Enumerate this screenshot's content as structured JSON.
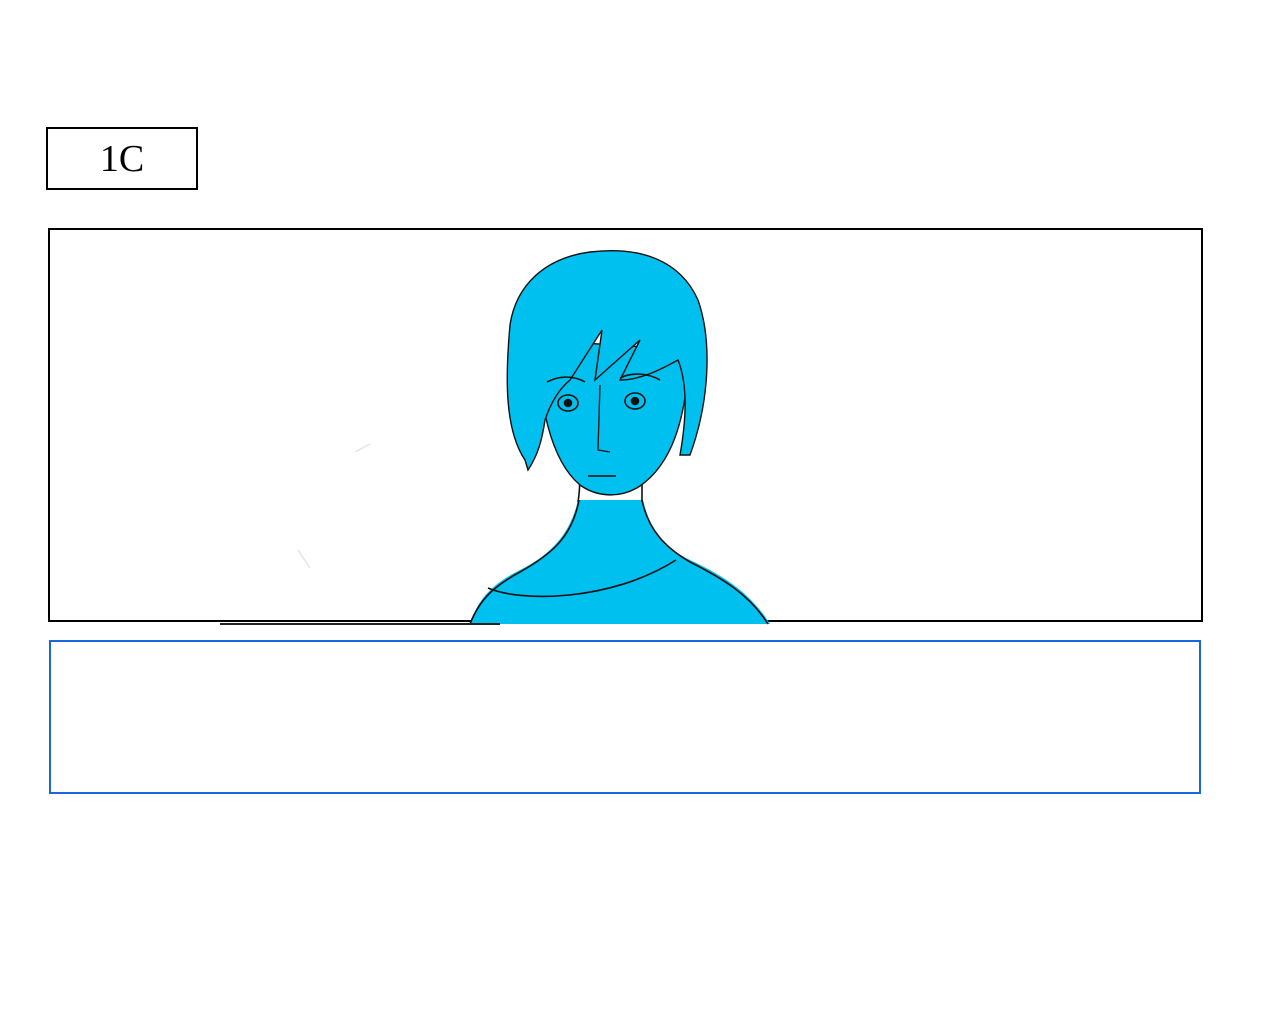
{
  "shot": {
    "label": "1C"
  },
  "panel": {
    "illustration": "character-sketch",
    "fill_color": "#00c0ef",
    "line_color": "#111111"
  },
  "notes": {
    "text": ""
  },
  "colors": {
    "notes_border": "#1a66e0",
    "frame_border": "#000000"
  }
}
